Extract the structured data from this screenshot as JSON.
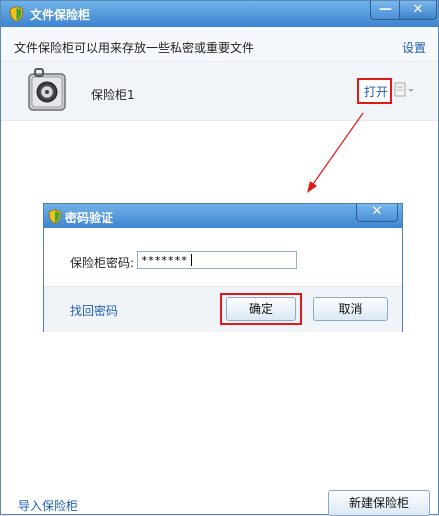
{
  "window": {
    "title": "文件保险柜",
    "minimize_glyph": "—",
    "close_glyph": "✕"
  },
  "header": {
    "description": "文件保险柜可以用来存放一些私密或重要文件",
    "settings_label": "设置"
  },
  "vault": {
    "name": "保险柜1",
    "open_label": "打开",
    "icon": "safe-icon"
  },
  "dialog": {
    "title": "密码验证",
    "close_glyph": "✕",
    "password_label": "保险柜密码:",
    "password_value": "*******",
    "retrieve_label": "找回密码",
    "ok_label": "确定",
    "cancel_label": "取消"
  },
  "footer": {
    "import_label": "导入保险柜",
    "new_label": "新建保险柜"
  },
  "colors": {
    "titlebar": "#3e84cf",
    "link": "#1f5fae",
    "highlight": "#e01919"
  }
}
